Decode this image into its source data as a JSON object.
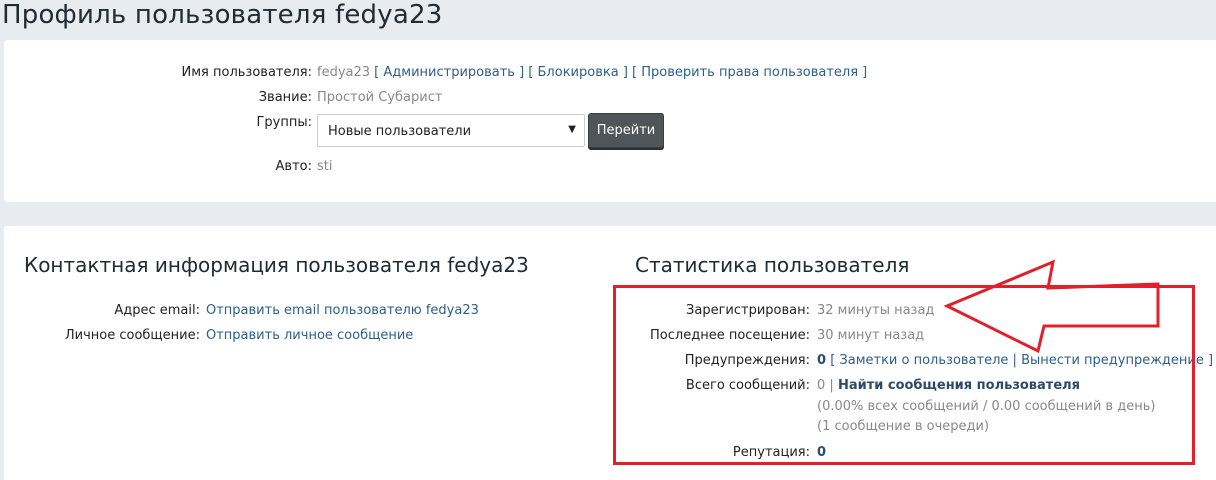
{
  "page": {
    "title": "Профиль пользователя fedya23"
  },
  "profile": {
    "username_label": "Имя пользователя:",
    "username": "fedya23",
    "admin_link": "Администрировать",
    "block_link": "Блокировка",
    "check_rights_link": "Проверить права пользователя",
    "rank_label": "Звание:",
    "rank": "Простой Субарист",
    "groups_label": "Группы:",
    "groups_selected": "Новые пользователи",
    "go_button": "Перейти",
    "avatar_label": "Авто:",
    "avatar_value": "sti"
  },
  "contact": {
    "title": "Контактная информация пользователя fedya23",
    "email_label": "Адрес email:",
    "email_link": "Отправить email пользователю fedya23",
    "pm_label": "Личное сообщение:",
    "pm_link": "Отправить личное сообщение"
  },
  "stats": {
    "title": "Статистика пользователя",
    "registered_label": "Зарегистрирован:",
    "registered_value": "32 минуты назад",
    "last_visit_label": "Последнее посещение:",
    "last_visit_value": "30 минут назад",
    "warnings_label": "Предупреждения:",
    "warnings_count": "0",
    "notes_link": "Заметки о пользователе",
    "warn_link": "Вынести предупреждение",
    "posts_label": "Всего сообщений:",
    "posts_count": "0",
    "find_posts_link": "Найти сообщения пользователя",
    "posts_percent": "(0.00% всех сообщений / 0.00 сообщений в день)",
    "posts_queue": "(1 сообщение в очереди)",
    "reputation_label": "Репутация:",
    "reputation_value": "0"
  },
  "colors": {
    "highlight": "#e0202a",
    "link": "#2d5f8a",
    "button": "#505559"
  }
}
